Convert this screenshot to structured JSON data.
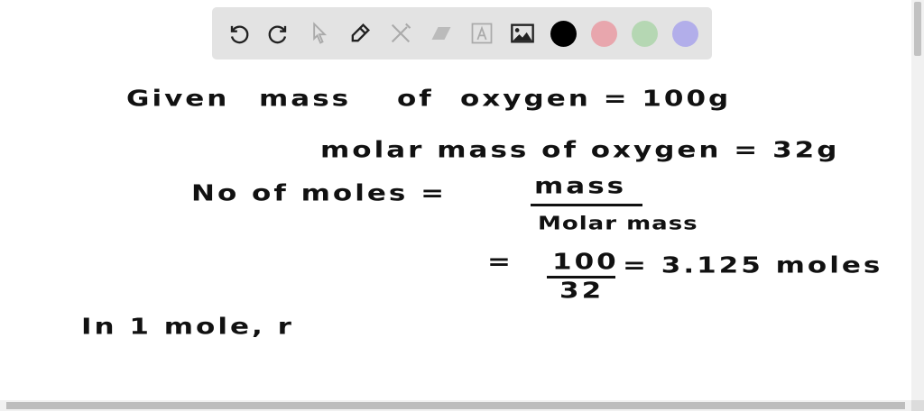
{
  "toolbar": {
    "tools": [
      {
        "name": "undo-icon",
        "enabled": true
      },
      {
        "name": "redo-icon",
        "enabled": true
      },
      {
        "name": "select-pointer-icon",
        "enabled": false
      },
      {
        "name": "pen-icon",
        "enabled": true
      },
      {
        "name": "tools-icon",
        "enabled": false
      },
      {
        "name": "eraser-icon",
        "enabled": false
      },
      {
        "name": "text-icon",
        "enabled": false
      },
      {
        "name": "image-icon",
        "enabled": true
      }
    ],
    "colors": [
      "#000000",
      "#e8a6ad",
      "#b5d7b3",
      "#b2aeea"
    ]
  },
  "board": {
    "line1": {
      "w1": "Given",
      "w2": "mass",
      "w3": "of",
      "w4": "oxygen = 100g"
    },
    "line2": "molar  mass  of  oxygen  =  32g",
    "line3": {
      "lhs": "No  of  moles  =",
      "num": "mass",
      "den": "Molar mass"
    },
    "line4": {
      "eq": "=",
      "num": "100",
      "den": "32",
      "result": "=  3.125  moles"
    },
    "line5": "In  1  mole,  r"
  }
}
